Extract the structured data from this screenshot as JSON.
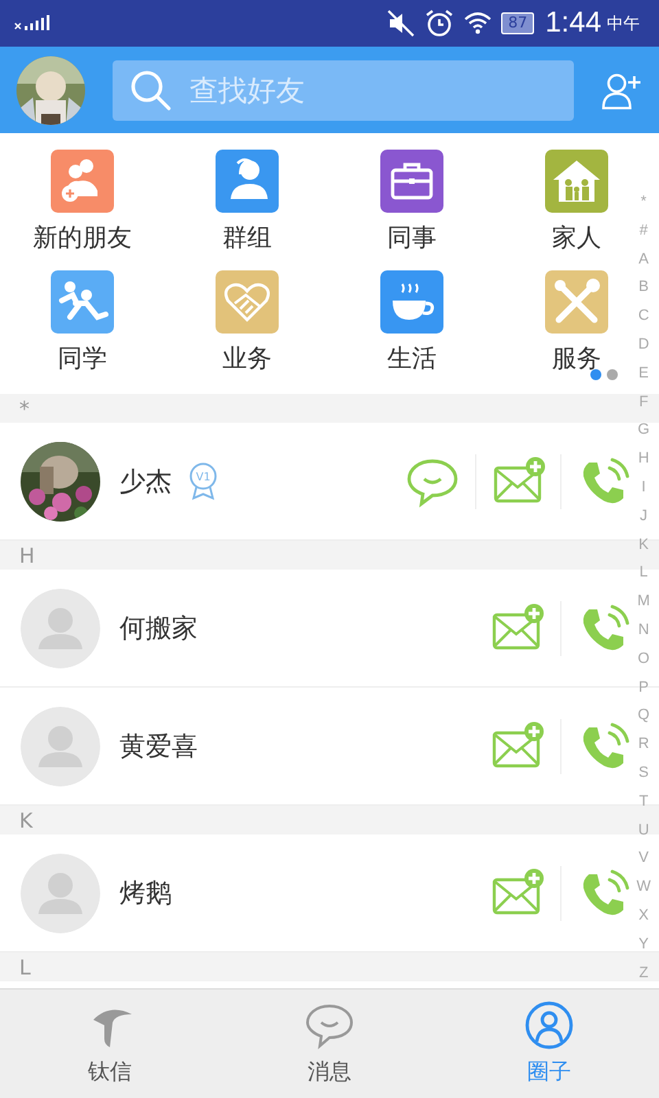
{
  "status_bar": {
    "battery": "87",
    "time": "1:44",
    "period": "中午"
  },
  "header": {
    "search": {
      "placeholder": "查找好友"
    }
  },
  "categories": [
    {
      "label": "新的朋友",
      "color": "#f78c68",
      "kind": "friends"
    },
    {
      "label": "群组",
      "color": "#3a97f0",
      "kind": "group"
    },
    {
      "label": "同事",
      "color": "#8a57d0",
      "kind": "briefcase"
    },
    {
      "label": "家人",
      "color": "#a3b540",
      "kind": "house"
    },
    {
      "label": "同学",
      "color": "#5aacf5",
      "kind": "runners"
    },
    {
      "label": "业务",
      "color": "#e2c27a",
      "kind": "handshake"
    },
    {
      "label": "生活",
      "color": "#3896f2",
      "kind": "cup"
    },
    {
      "label": "服务",
      "color": "#e3c57d",
      "kind": "tools"
    }
  ],
  "pager": [
    {
      "selected": true
    },
    {
      "selected": false
    }
  ],
  "sections": [
    {
      "letter": "*",
      "contacts": [
        {
          "name": "少杰",
          "badge": "V1",
          "actions": [
            {
              "kind": "chat"
            },
            {
              "kind": "mail"
            },
            {
              "kind": "call"
            }
          ]
        }
      ]
    },
    {
      "letter": "H",
      "contacts": [
        {
          "name": "何搬家",
          "kind": "default",
          "actions": [
            {
              "kind": "mail"
            },
            {
              "kind": "call"
            }
          ]
        },
        {
          "name": "黄爱喜",
          "kind": "default",
          "actions": [
            {
              "kind": "mail"
            },
            {
              "kind": "call"
            }
          ]
        }
      ]
    },
    {
      "letter": "K",
      "contacts": [
        {
          "name": "烤鹅",
          "kind": "default",
          "actions": [
            {
              "kind": "mail"
            },
            {
              "kind": "call"
            }
          ]
        }
      ]
    },
    {
      "letter": "L"
    }
  ],
  "index": [
    "*",
    "#",
    "A",
    "B",
    "C",
    "D",
    "E",
    "F",
    "G",
    "H",
    "I",
    "J",
    "K",
    "L",
    "M",
    "N",
    "O",
    "P",
    "Q",
    "R",
    "S",
    "T",
    "U",
    "V",
    "W",
    "X",
    "Y",
    "Z"
  ],
  "tabs": [
    {
      "label": "钛信",
      "kind": "feather",
      "selected": false
    },
    {
      "label": "消息",
      "kind": "chat",
      "selected": false
    },
    {
      "label": "圈子",
      "kind": "person",
      "selected": true
    }
  ]
}
